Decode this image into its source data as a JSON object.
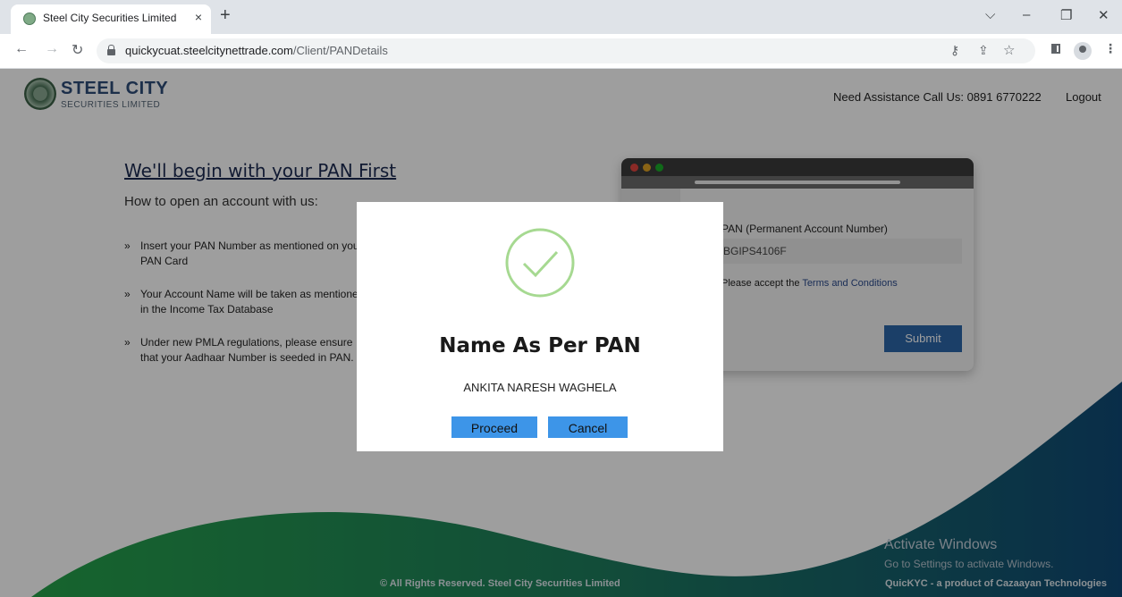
{
  "browser": {
    "tab_title": "Steel City Securities Limited",
    "tab_close": "×",
    "new_tab": "+",
    "url_domain": "quickycuat.steelcitynettrade.com",
    "url_path": "/Client/PANDetails",
    "controls": {
      "dropdown": "⌵",
      "minimize": "–",
      "restore": "❐",
      "close": "✕"
    }
  },
  "header": {
    "logo_title": "STEEL CITY",
    "logo_subtitle": "SECURITIES LIMITED",
    "assistance": "Need Assistance Call Us: 0891 6770222",
    "logout": "Logout"
  },
  "intro": {
    "heading": "We'll begin with your PAN First",
    "subheading": "How to open an account with us:",
    "bullets": [
      "Insert your PAN Number as mentioned on your PAN Card",
      "Your Account Name will be taken as mentioned in the Income Tax Database",
      "Under new PMLA regulations, please ensure that your Aadhaar Number is seeded in PAN."
    ]
  },
  "form": {
    "label": "PAN (Permanent Account Number)",
    "pan_value": "BGIPS4106F",
    "terms_prefix": "Please accept the",
    "terms_link": "Terms and Conditions",
    "submit": "Submit"
  },
  "footer": {
    "copyright": "© All Rights Reserved. Steel City Securities Limited",
    "product": "QuicKYC - a product of Cazaayan Technologies"
  },
  "watermark": {
    "line1": "Activate Windows",
    "line2": "Go to Settings to activate Windows."
  },
  "modal": {
    "title": "Name As Per PAN",
    "name": "ANKITA NARESH WAGHELA",
    "proceed": "Proceed",
    "cancel": "Cancel"
  }
}
